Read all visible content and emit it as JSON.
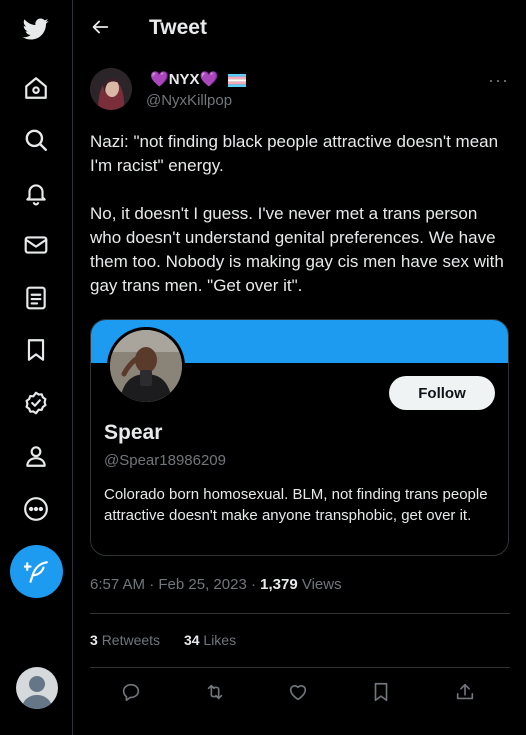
{
  "sidebar": {
    "items": [
      {
        "icon": "twitter-logo-icon"
      },
      {
        "icon": "home-icon"
      },
      {
        "icon": "explore-icon"
      },
      {
        "icon": "notifications-icon"
      },
      {
        "icon": "messages-icon"
      },
      {
        "icon": "lists-icon"
      },
      {
        "icon": "bookmarks-icon"
      },
      {
        "icon": "verified-icon"
      },
      {
        "icon": "profile-icon"
      },
      {
        "icon": "more-icon"
      }
    ],
    "compose_icon": "compose-tweet-icon"
  },
  "header": {
    "title": "Tweet",
    "back_icon": "back-arrow-icon"
  },
  "tweet": {
    "author": {
      "display_name_text": "NYX",
      "emoji_left": "💜",
      "emoji_right": "💜",
      "handle": "@NyxKillpop"
    },
    "paragraph_1": "Nazi: \"not finding black people attractive doesn't mean I'm racist\" energy.",
    "paragraph_2": "No, it doesn't I guess. I've never met a trans person who doesn't understand genital preferences. We have them too. Nobody is making gay cis men have sex with gay trans men. \"Get over it\".",
    "card": {
      "follow_label": "Follow",
      "name": "Spear",
      "handle": "@Spear18986209",
      "bio": "Colorado born homosexual. BLM, not finding trans people attractive doesn't make anyone transphobic, get over it."
    },
    "time": "6:57 AM",
    "date": "Feb 25, 2023",
    "views_count": "1,379",
    "views_label": "Views",
    "retweets_count": "3",
    "retweets_label": "Retweets",
    "likes_count": "34",
    "likes_label": "Likes"
  },
  "colors": {
    "accent": "#1d9bf0",
    "muted": "#71767b",
    "border": "#2f3336",
    "text": "#e7e9ea",
    "heart": "#b57bff"
  }
}
